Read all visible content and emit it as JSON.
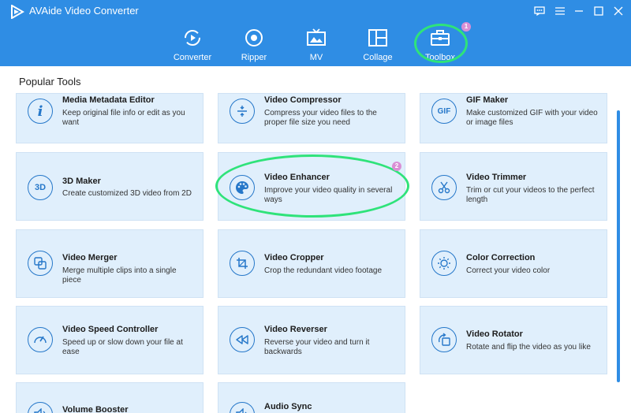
{
  "app": {
    "title": "AVAide Video Converter"
  },
  "window_controls": [
    {
      "name": "feedback-icon"
    },
    {
      "name": "menu-icon"
    },
    {
      "name": "minimize-icon"
    },
    {
      "name": "maximize-icon"
    },
    {
      "name": "close-icon"
    }
  ],
  "nav": {
    "tabs": [
      {
        "label": "Converter",
        "icon": "converter-icon"
      },
      {
        "label": "Ripper",
        "icon": "ripper-icon"
      },
      {
        "label": "MV",
        "icon": "mv-icon"
      },
      {
        "label": "Collage",
        "icon": "collage-icon"
      },
      {
        "label": "Toolbox",
        "icon": "toolbox-icon",
        "active": true
      }
    ]
  },
  "annotations": {
    "badge1": "1",
    "badge2": "2",
    "highlight_color": "#2fe37a",
    "badge_color": "#d98fd5"
  },
  "section": {
    "title": "Popular Tools"
  },
  "tools": [
    {
      "title": "Media Metadata Editor",
      "desc": "Keep original file info or edit as you want",
      "icon": "info-icon",
      "glyph": "i"
    },
    {
      "title": "Video Compressor",
      "desc": "Compress your video files to the proper file size you need",
      "icon": "compress-icon"
    },
    {
      "title": "GIF Maker",
      "desc": "Make customized GIF with your video or image files",
      "icon": "gif-icon",
      "glyph": "GIF"
    },
    {
      "title": "3D Maker",
      "desc": "Create customized 3D video from 2D",
      "icon": "3d-icon",
      "glyph": "3D"
    },
    {
      "title": "Video Enhancer",
      "desc": "Improve your video quality in several ways",
      "icon": "palette-icon"
    },
    {
      "title": "Video Trimmer",
      "desc": "Trim or cut your videos to the perfect length",
      "icon": "scissors-icon"
    },
    {
      "title": "Video Merger",
      "desc": "Merge multiple clips into a single piece",
      "icon": "merge-icon"
    },
    {
      "title": "Video Cropper",
      "desc": "Crop the redundant video footage",
      "icon": "crop-icon"
    },
    {
      "title": "Color Correction",
      "desc": "Correct your video color",
      "icon": "sun-icon"
    },
    {
      "title": "Video Speed Controller",
      "desc": "Speed up or slow down your file at ease",
      "icon": "speedometer-icon"
    },
    {
      "title": "Video Reverser",
      "desc": "Reverse your video and turn it backwards",
      "icon": "rewind-icon"
    },
    {
      "title": "Video Rotator",
      "desc": "Rotate and flip the video as you like",
      "icon": "rotate-icon"
    },
    {
      "title": "Volume Booster",
      "desc": "",
      "icon": "volume-icon"
    },
    {
      "title": "Audio Sync",
      "desc": "",
      "icon": "audio-sync-icon"
    }
  ],
  "colors": {
    "brand": "#2f8de4",
    "tile_bg": "#e0effc",
    "icon_blue": "#2577c9"
  }
}
